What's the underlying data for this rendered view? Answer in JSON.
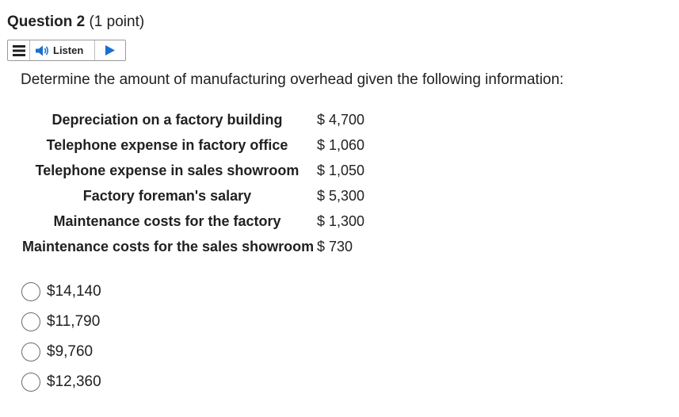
{
  "question": {
    "title": "Question 2",
    "points": "(1 point)"
  },
  "listen_bar": {
    "menu_icon": "hamburger-menu-icon",
    "speaker_icon": "speaker-icon",
    "listen_label": "Listen",
    "play_icon": "play-icon"
  },
  "prompt": "Determine the amount of manufacturing overhead given the following information:",
  "costs": [
    {
      "label": "Depreciation on a factory building",
      "value": "$ 4,700"
    },
    {
      "label": "Telephone expense in factory office",
      "value": "$ 1,060"
    },
    {
      "label": "Telephone expense in sales showroom",
      "value": "$ 1,050"
    },
    {
      "label": "Factory foreman's salary",
      "value": "$ 5,300"
    },
    {
      "label": "Maintenance costs for the factory",
      "value": "$ 1,300"
    },
    {
      "label": "Maintenance costs for the sales showroom",
      "value": "$ 730"
    }
  ],
  "options": [
    {
      "label": "$14,140",
      "selected": false
    },
    {
      "label": "$11,790",
      "selected": false
    },
    {
      "label": "$9,760",
      "selected": false
    },
    {
      "label": "$12,360",
      "selected": false
    }
  ],
  "colors": {
    "text": "#202122",
    "border": "#9a9a9a",
    "speaker_blue": "#1a6fd0",
    "icon_dark": "#222222"
  }
}
